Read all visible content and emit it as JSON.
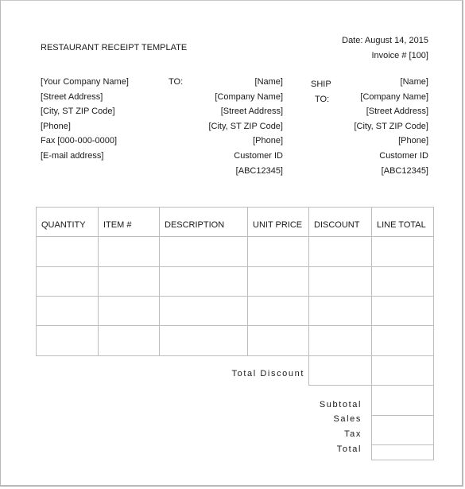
{
  "document": {
    "title": "RESTAURANT RECEIPT TEMPLATE",
    "date": "Date: August 14, 2015",
    "invoice": "Invoice # [100]"
  },
  "from": {
    "lines": [
      "[Your Company Name]",
      "[Street Address]",
      "[City, ST  ZIP Code]",
      "[Phone]",
      "Fax [000-000-0000]",
      "[E-mail address]"
    ]
  },
  "to": {
    "label": "TO:",
    "lines": [
      "[Name]",
      "[Company Name]",
      "[Street Address]",
      "[City, ST  ZIP Code]",
      "[Phone]",
      "Customer ID",
      "[ABC12345]"
    ]
  },
  "ship_to": {
    "label_line1": "SHIP",
    "label_line2": "TO:",
    "lines": [
      "[Name]",
      "[Company Name]",
      "[Street Address]",
      "[City, ST  ZIP Code]",
      "[Phone]",
      "Customer ID",
      "[ABC12345]"
    ]
  },
  "table": {
    "columns": [
      "QUANTITY",
      "ITEM #",
      "DESCRIPTION",
      "UNIT PRICE",
      "DISCOUNT",
      "LINE TOTAL"
    ],
    "rows": [
      [
        "",
        "",
        "",
        "",
        "",
        ""
      ],
      [
        "",
        "",
        "",
        "",
        "",
        ""
      ],
      [
        "",
        "",
        "",
        "",
        "",
        ""
      ],
      [
        "",
        "",
        "",
        "",
        "",
        ""
      ]
    ]
  },
  "totals": {
    "total_discount_label": "Total Discount",
    "subtotal_label": "Subtotal",
    "sales_label": "Sales",
    "tax_label": "Tax",
    "total_label": "Total",
    "total_discount_value": "",
    "subtotal_value": "",
    "sales_tax_value": "",
    "total_value": ""
  }
}
